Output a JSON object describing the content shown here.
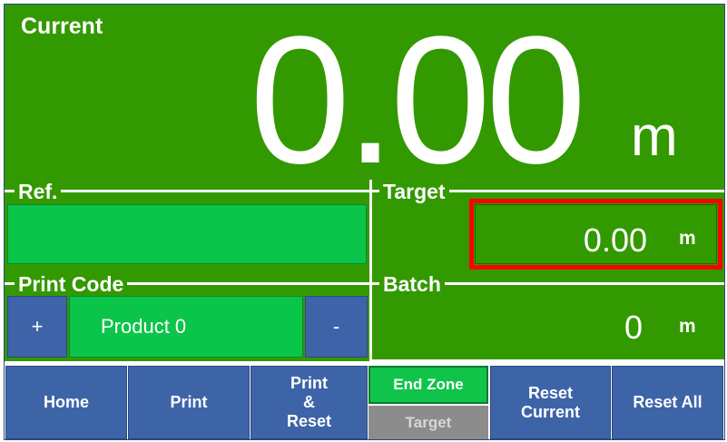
{
  "current": {
    "label": "Current",
    "value": "0.00",
    "unit": "m"
  },
  "ref": {
    "label": "Ref.",
    "value": ""
  },
  "target": {
    "label": "Target",
    "value": "0.00",
    "unit": "m"
  },
  "print_code": {
    "label": "Print Code",
    "plus": "+",
    "value": "Product 0",
    "minus": "-"
  },
  "batch": {
    "label": "Batch",
    "value": "0",
    "unit": "m"
  },
  "buttons": {
    "home": "Home",
    "print": "Print",
    "print_reset_1": "Print",
    "print_reset_2": "&",
    "print_reset_3": "Reset",
    "end_zone": "End Zone",
    "target": "Target",
    "reset_current_1": "Reset",
    "reset_current_2": "Current",
    "reset_all": "Reset All"
  },
  "colors": {
    "panel": "#339900",
    "field": "#0bc44a",
    "button": "#3e64a8",
    "highlight": "#ff0000",
    "disabled": "#8c8c8c"
  }
}
